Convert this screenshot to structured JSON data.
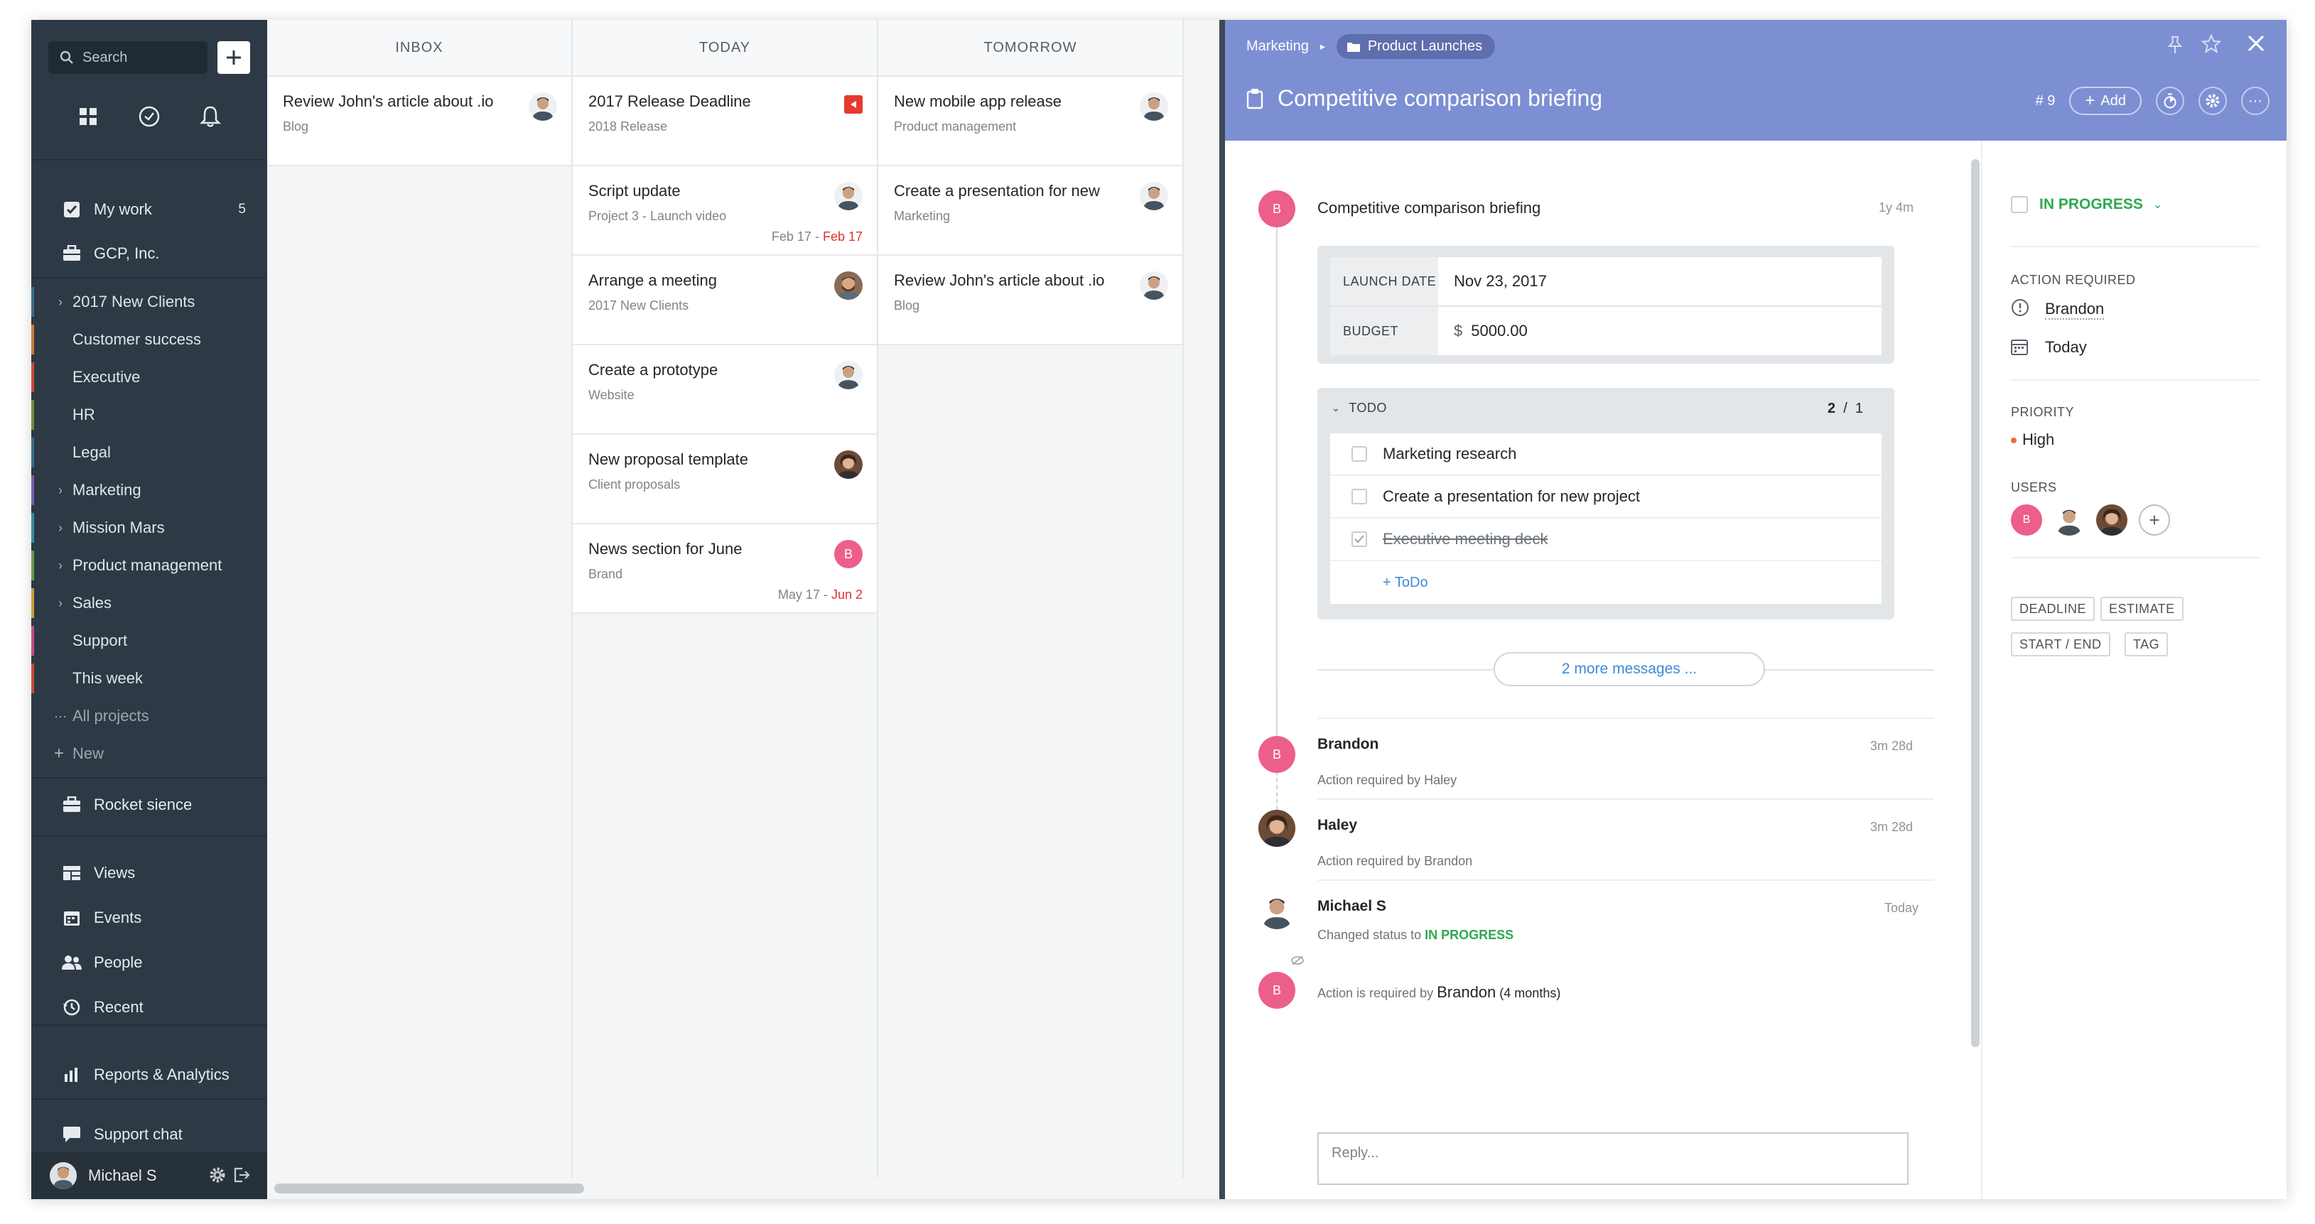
{
  "sidebar": {
    "search_label": "Search",
    "my_work": {
      "label": "My work",
      "count": "5"
    },
    "workspace": "GCP, Inc.",
    "projects": [
      {
        "label": "2017 New Clients",
        "expandable": true,
        "color": "#3a6d8c"
      },
      {
        "label": "Customer success",
        "expandable": false,
        "color": "#c77d3a"
      },
      {
        "label": "Executive",
        "expandable": false,
        "color": "#c74c3a"
      },
      {
        "label": "HR",
        "expandable": false,
        "color": "#7b8a3a"
      },
      {
        "label": "Legal",
        "expandable": false,
        "color": "#3a6d8c"
      },
      {
        "label": "Marketing",
        "expandable": true,
        "color": "#7a5fb0"
      },
      {
        "label": "Mission Mars",
        "expandable": true,
        "color": "#3a8ca3"
      },
      {
        "label": "Product management",
        "expandable": true,
        "color": "#6a9b4a"
      },
      {
        "label": "Sales",
        "expandable": true,
        "color": "#c7a03a"
      },
      {
        "label": "Support",
        "expandable": false,
        "color": "#c74c8a"
      },
      {
        "label": "This week",
        "expandable": false,
        "color": "#c74c3a"
      }
    ],
    "all_projects": "All projects",
    "new": "New",
    "rocket": "Rocket sience",
    "nav": [
      {
        "label": "Views",
        "icon": "views-icon"
      },
      {
        "label": "Events",
        "icon": "calendar-icon"
      },
      {
        "label": "People",
        "icon": "people-icon"
      },
      {
        "label": "Recent",
        "icon": "history-icon"
      }
    ],
    "reports": "Reports & Analytics",
    "support_chat": "Support chat",
    "user": "Michael S"
  },
  "board": {
    "columns": [
      {
        "title": "INBOX",
        "cards": [
          {
            "title": "Review John's article about .io",
            "subtitle": "Blog",
            "avatar": "man"
          }
        ]
      },
      {
        "title": "TODAY",
        "cards": [
          {
            "title": "2017 Release Deadline",
            "subtitle": "2018 Release",
            "flag": true
          },
          {
            "title": "Script update",
            "subtitle": "Project 3 - Launch video",
            "avatar": "man",
            "date_start": "Feb 17 - ",
            "date_end": "Feb 17"
          },
          {
            "title": "Arrange a meeting",
            "subtitle": "2017 New Clients",
            "avatar": "bearded"
          },
          {
            "title": "Create a prototype",
            "subtitle": "Website",
            "avatar": "man"
          },
          {
            "title": "New proposal template",
            "subtitle": "Client proposals",
            "avatar": "woman"
          },
          {
            "title": "News section for June",
            "subtitle": "Brand",
            "avatar_letter": "B",
            "date_start": "May 17 - ",
            "date_end": "Jun 2"
          }
        ]
      },
      {
        "title": "TOMORROW",
        "cards": [
          {
            "title": "New mobile app release",
            "subtitle": "Product management",
            "avatar": "man"
          },
          {
            "title": "Create a presentation for new",
            "subtitle": "Marketing",
            "avatar": "man"
          },
          {
            "title": "Review John's article about .io",
            "subtitle": "Blog",
            "avatar": "man"
          }
        ]
      }
    ]
  },
  "panel": {
    "breadcrumb_parent": "Marketing",
    "breadcrumb_folder": "Product Launches",
    "title": "Competitive comparison briefing",
    "task_number": "# 9",
    "add_label": "Add",
    "feed": {
      "first_letter": "B",
      "first_text": "Competitive comparison briefing",
      "first_time": "1y 4m",
      "fields": [
        {
          "key": "LAUNCH DATE",
          "value": "Nov 23, 2017",
          "prefix": ""
        },
        {
          "key": "BUDGET",
          "value": "5000.00",
          "prefix": "$"
        }
      ],
      "todo": {
        "title": "TODO",
        "done": "2",
        "sep": "/",
        "total": "1",
        "items": [
          {
            "text": "Marketing research",
            "done": false
          },
          {
            "text": "Create a presentation for new project",
            "done": false
          },
          {
            "text": "Executive meeting deck",
            "done": true
          }
        ],
        "add_label": "+ ToDo"
      },
      "more_messages": "2 more messages ...",
      "messages": [
        {
          "author": "Brandon",
          "letter": "B",
          "text": "Action required by Haley",
          "time": "3m 28d"
        },
        {
          "author": "Haley",
          "text": "Action required by Brandon",
          "time": "3m 28d"
        },
        {
          "author": "Michael S",
          "text_prefix": "Changed status to ",
          "status": "IN PROGRESS",
          "time": "Today"
        }
      ],
      "last": {
        "letter": "B",
        "prefix": "Action is required by ",
        "name": "Brandon",
        "suffix": "(4 months)"
      },
      "reply_placeholder": "Reply..."
    },
    "side": {
      "status": "IN PROGRESS",
      "status_color": "#2fa84f",
      "action_required_label": "ACTION REQUIRED",
      "assignee": "Brandon",
      "due": "Today",
      "priority_label": "PRIORITY",
      "priority": "High",
      "priority_color": "#f06a3c",
      "users_label": "USERS",
      "user_letter": "B",
      "tags": [
        "DEADLINE",
        "ESTIMATE",
        "START / END",
        "TAG"
      ]
    }
  },
  "colors": {
    "sidebar": "#2d3a45",
    "header": "#7d8fd3",
    "accent": "#3d8ad8",
    "avatar_pink": "#ec5f8a",
    "date_red": "#e0312a"
  }
}
